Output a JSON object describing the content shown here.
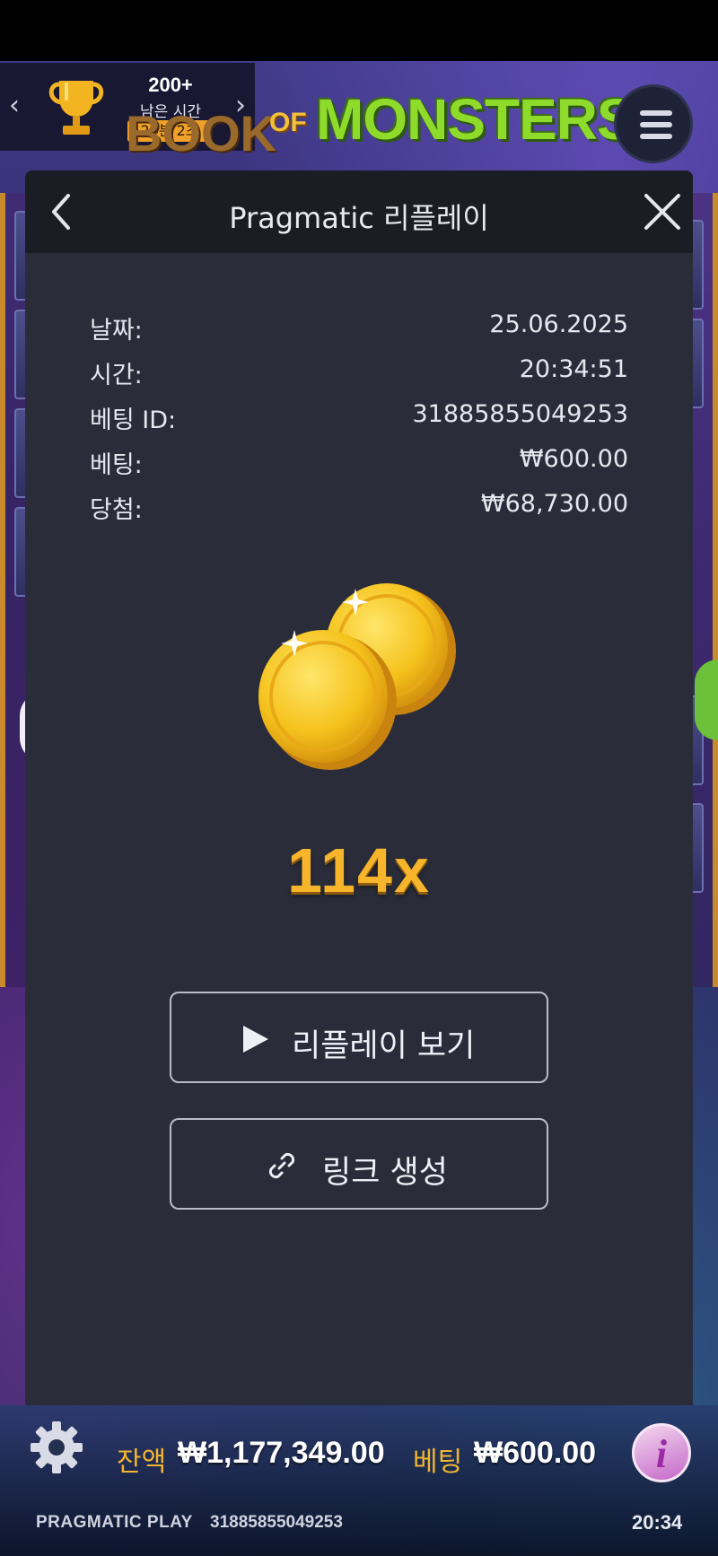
{
  "tournament": {
    "rank": "200+",
    "time_label": "남은 시간",
    "time_remaining": "24분 2초"
  },
  "game_logo": {
    "prefix": "BOOK",
    "of": "OF",
    "name": "MONSTERS"
  },
  "modal": {
    "title": "Pragmatic 리플레이",
    "rows": [
      {
        "label": "날짜:",
        "value": "25.06.2025"
      },
      {
        "label": "시간:",
        "value": "20:34:51"
      },
      {
        "label": "베팅 ID:",
        "value": "31885855049253"
      },
      {
        "label": "베팅:",
        "value": "₩600.00"
      },
      {
        "label": "당첨:",
        "value": "₩68,730.00"
      }
    ],
    "multiplier": "114x",
    "buttons": {
      "watch_replay": "리플레이 보기",
      "create_link": "링크 생성"
    }
  },
  "bottom_bar": {
    "balance_label": "잔액",
    "balance_value": "₩1,177,349.00",
    "bet_label": "베팅",
    "bet_value": "₩600.00",
    "brand": "PRAGMATIC PLAY",
    "round_id": "31885855049253",
    "clock": "20:34"
  },
  "colors": {
    "accent_gold": "#f6b52a",
    "modal_bg": "#2a2d39",
    "modal_header_bg": "#1b1d25"
  }
}
